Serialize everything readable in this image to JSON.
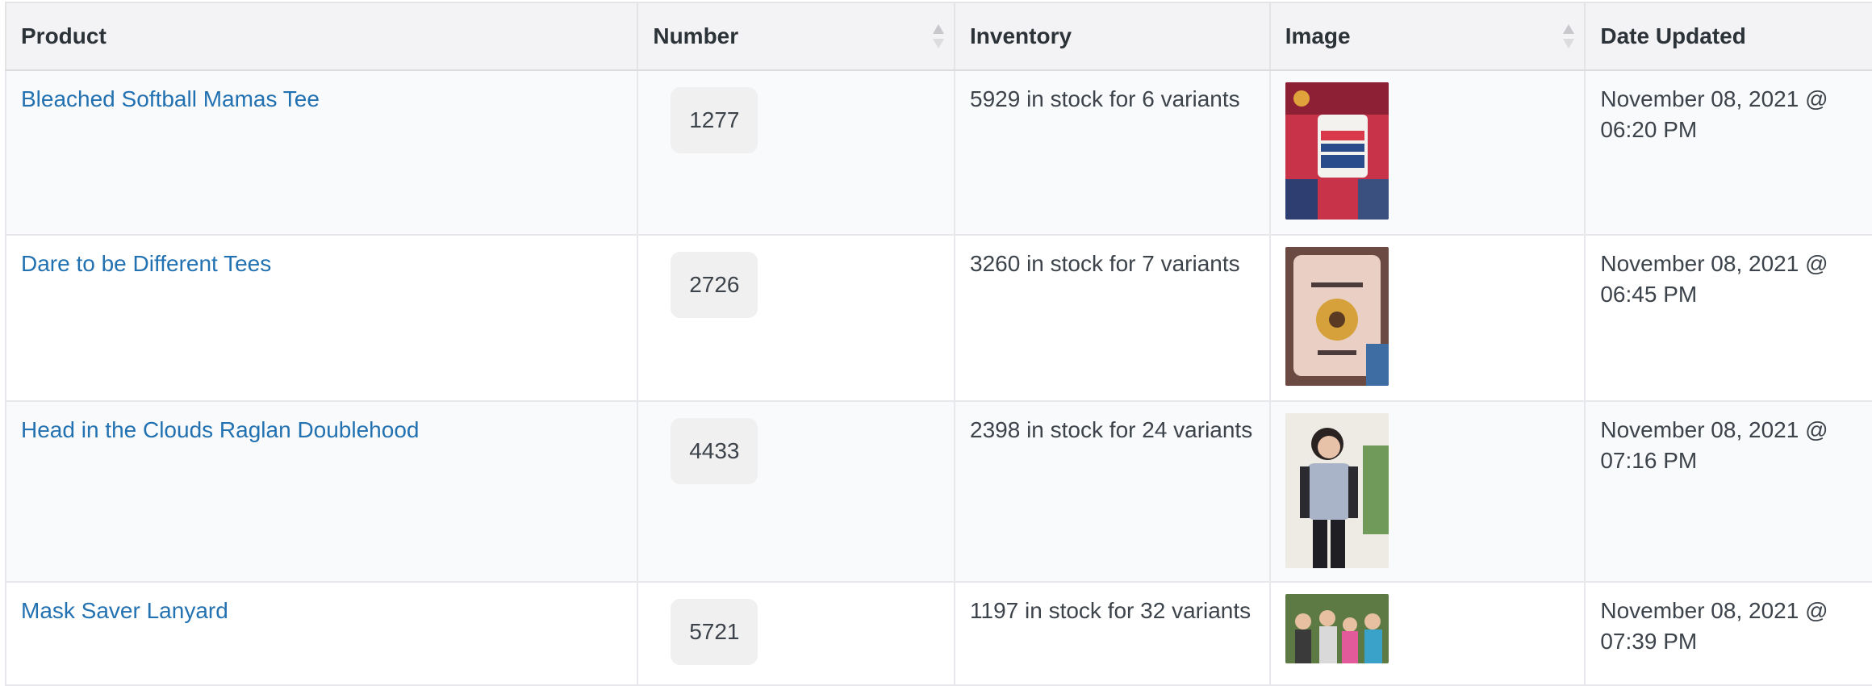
{
  "columns": {
    "product": "Product",
    "number": "Number",
    "inventory": "Inventory",
    "image": "Image",
    "date": "Date Updated"
  },
  "rows": [
    {
      "product": "Bleached Softball Mamas Tee",
      "number": "1277",
      "inventory": "5929 in stock for 6 variants",
      "image_alt": "softball-mamas-tee-photo",
      "date": "November 08, 2021 @ 06:20 PM"
    },
    {
      "product": "Dare to be Different Tees",
      "number": "2726",
      "inventory": "3260 in stock for 7 variants",
      "image_alt": "dare-to-be-different-tee-photo",
      "date": "November 08, 2021 @ 06:45 PM"
    },
    {
      "product": "Head in the Clouds Raglan Doublehood",
      "number": "4433",
      "inventory": "2398 in stock for 24 variants",
      "image_alt": "raglan-doublehood-photo",
      "date": "November 08, 2021 @ 07:16 PM"
    },
    {
      "product": "Mask Saver Lanyard",
      "number": "5721",
      "inventory": "1197 in stock for 32 variants",
      "image_alt": "mask-saver-lanyard-photo",
      "date": "November 08, 2021 @ 07:39 PM"
    }
  ],
  "colors": {
    "link": "#2271b1",
    "header_bg": "#f3f2f5",
    "odd_row_bg": "#f9fafc",
    "badge_bg": "#f0f0f1"
  }
}
